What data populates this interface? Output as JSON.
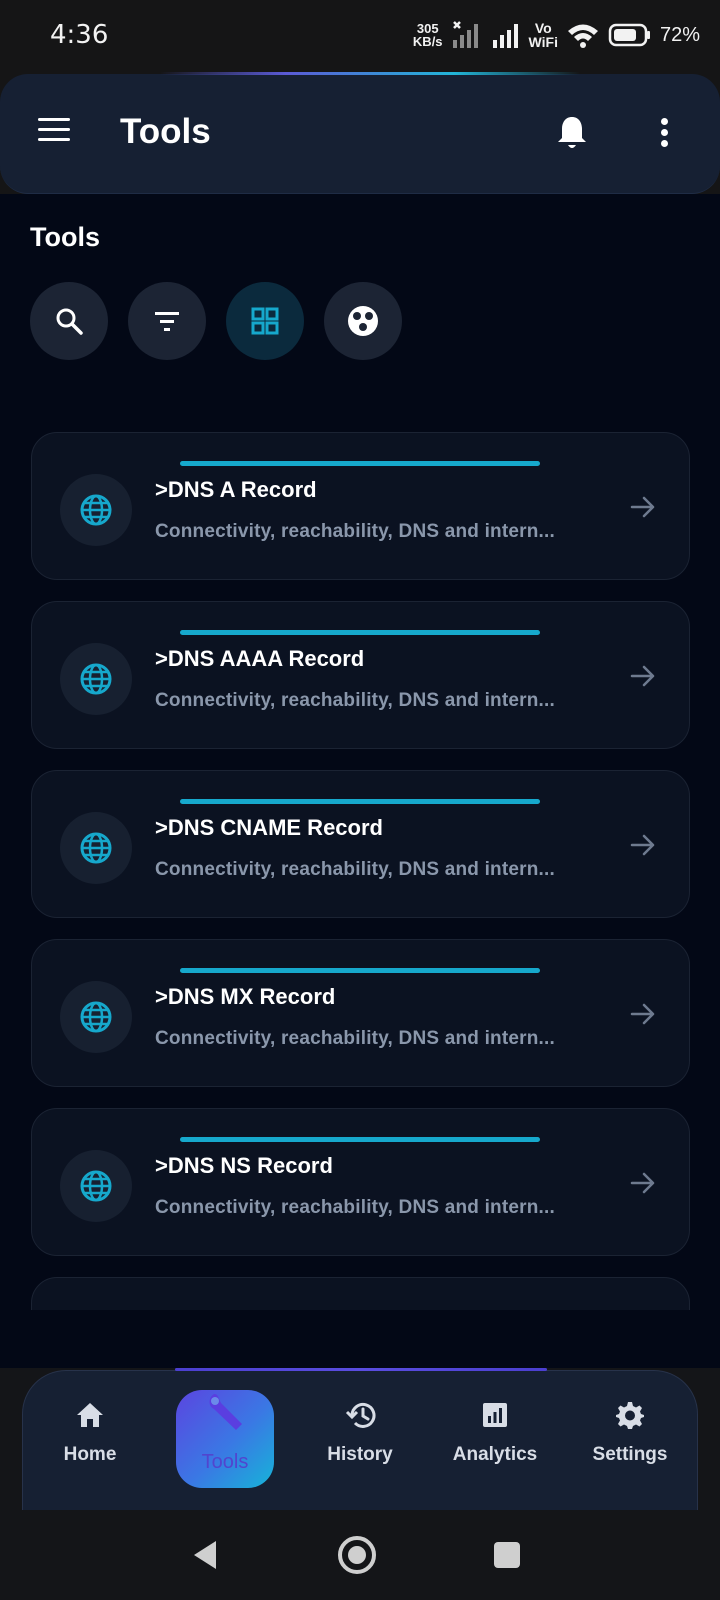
{
  "status_bar": {
    "time": "4:36",
    "net_speed_value": "305",
    "net_speed_unit": "KB/s",
    "vowifi_top": "Vo",
    "vowifi_bottom": "WiFi",
    "battery_percent": "72%"
  },
  "app_bar": {
    "title": "Tools",
    "menu_icon": "hamburger-menu-icon",
    "notification_icon": "bell-icon",
    "more_icon": "more-vert-icon"
  },
  "section": {
    "title": "Tools",
    "chips": [
      {
        "icon": "search-icon",
        "active": false
      },
      {
        "icon": "filter-icon",
        "active": false
      },
      {
        "icon": "grid-view-icon",
        "active": true
      },
      {
        "icon": "palette-icon",
        "active": false
      }
    ]
  },
  "tools": [
    {
      "title": ">DNS A Record",
      "subtitle": "Connectivity, reachability, DNS and intern...",
      "icon": "globe-icon"
    },
    {
      "title": ">DNS AAAA Record",
      "subtitle": "Connectivity, reachability, DNS and intern...",
      "icon": "globe-icon"
    },
    {
      "title": ">DNS CNAME Record",
      "subtitle": "Connectivity, reachability, DNS and intern...",
      "icon": "globe-icon"
    },
    {
      "title": ">DNS MX Record",
      "subtitle": "Connectivity, reachability, DNS and intern...",
      "icon": "globe-icon"
    },
    {
      "title": ">DNS NS Record",
      "subtitle": "Connectivity, reachability, DNS and intern...",
      "icon": "globe-icon"
    }
  ],
  "bottom_nav": {
    "items": [
      {
        "label": "Home",
        "icon": "home-icon"
      },
      {
        "label": "Tools",
        "icon": "wrench-icon",
        "active": true
      },
      {
        "label": "History",
        "icon": "history-icon"
      },
      {
        "label": "Analytics",
        "icon": "analytics-icon"
      },
      {
        "label": "Settings",
        "icon": "gear-icon"
      }
    ]
  },
  "colors": {
    "background": "#030816",
    "surface": "#162033",
    "card": "#0b1221",
    "accent_cyan": "#16a8cc",
    "accent_indigo": "#5b45e0",
    "muted_text": "#8a97ab"
  }
}
